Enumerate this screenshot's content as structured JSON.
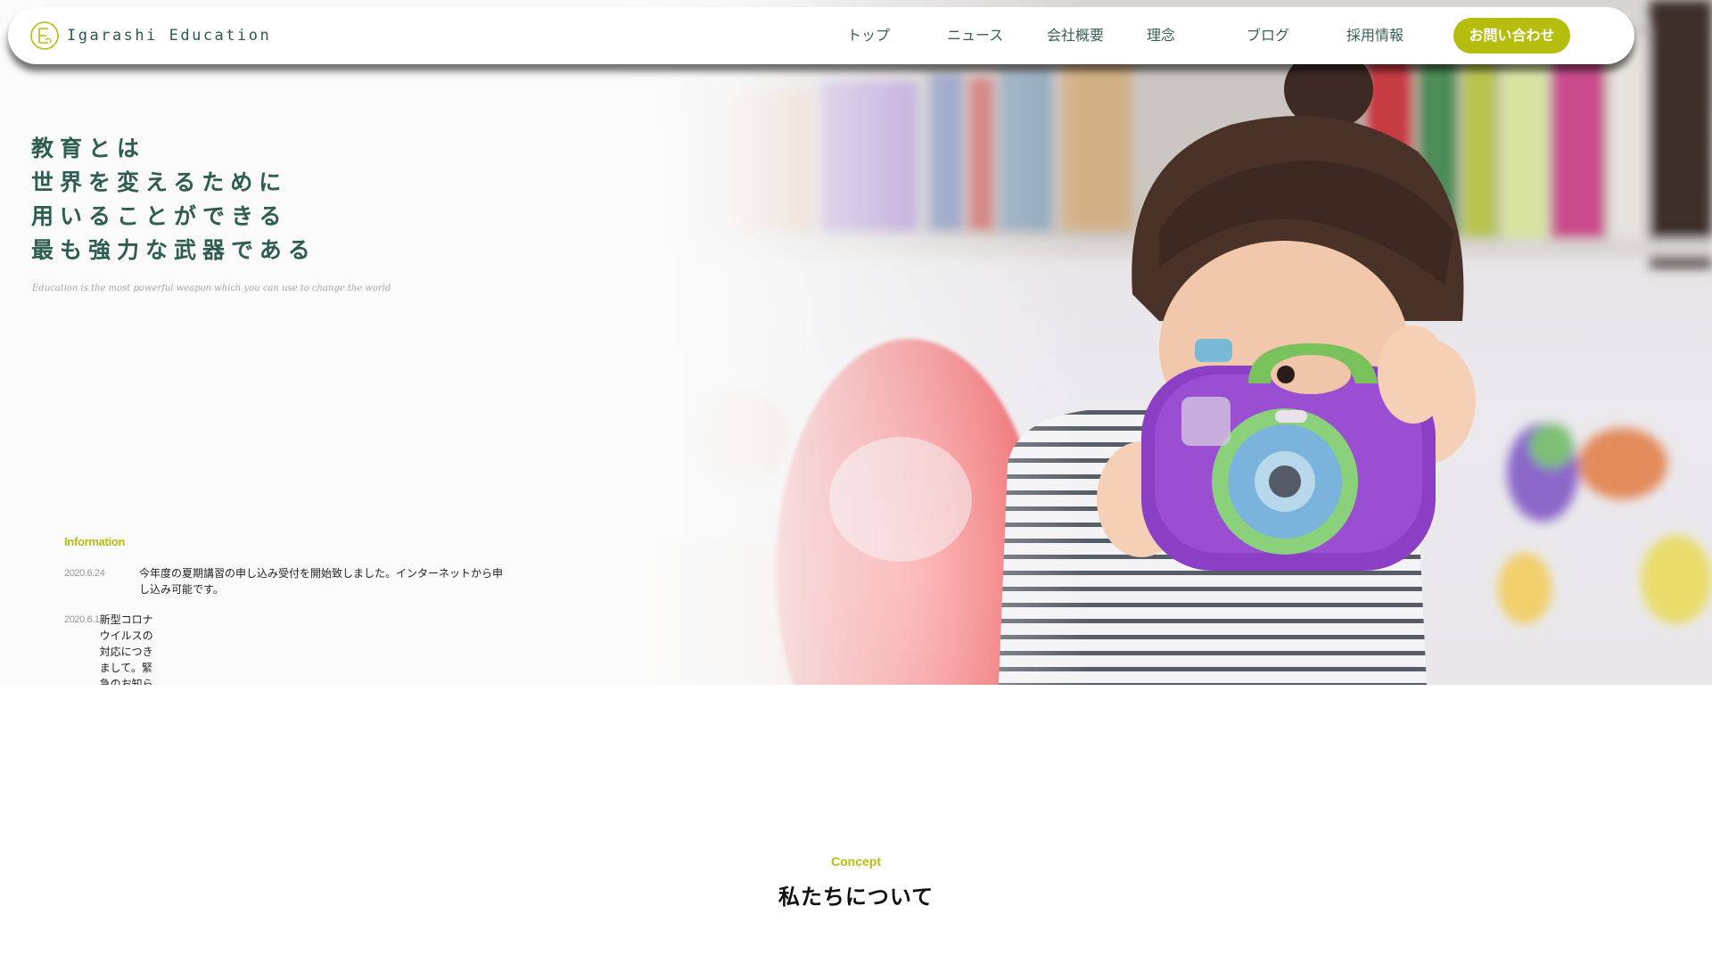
{
  "brand": {
    "name": "Igarashi Education",
    "accent_color": "#b5bd0f",
    "text_color": "#2f5d52"
  },
  "nav": {
    "items": [
      {
        "label": "トップ"
      },
      {
        "label": "ニュース"
      },
      {
        "label": "会社概要"
      },
      {
        "label": "理念"
      },
      {
        "label": "ブログ"
      },
      {
        "label": "採用情報"
      }
    ],
    "contact_label": "お問い合わせ"
  },
  "hero": {
    "headline_lines": [
      "教育とは",
      "世界を変えるために",
      "用いることができる",
      "最も強力な武器である"
    ],
    "subtitle": "Education is the most powerful weapon which you can use to change the world",
    "image_subject": "child holding a purple toy camera"
  },
  "information": {
    "heading": "Information",
    "items": [
      {
        "date": "2020.6.24",
        "text": "今年度の夏期講習の申し込み受付を開始致しました。インターネットから申し込み可能です。"
      },
      {
        "date": "2020.6.1",
        "text": "新型コロナウイルスの対応につきまして。緊急のお知らせです。"
      }
    ]
  },
  "concept": {
    "label": "Concept",
    "title": "私たちについて"
  }
}
